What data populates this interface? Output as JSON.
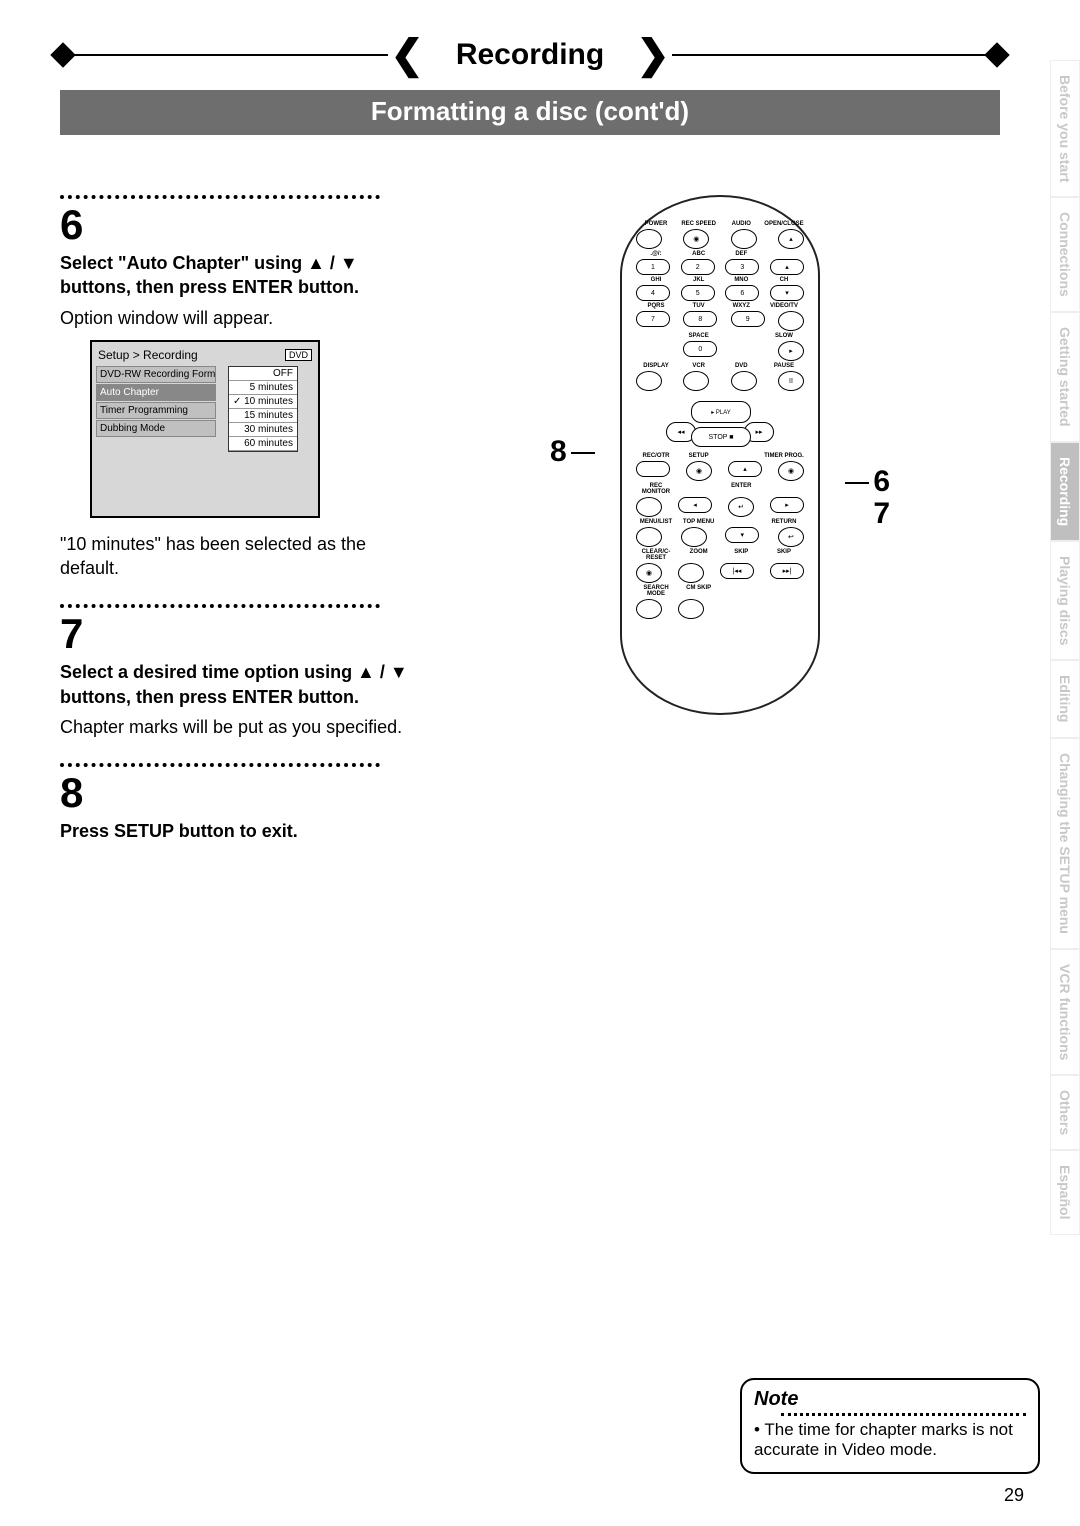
{
  "header": {
    "title": "Recording",
    "subtitle": "Formatting a disc (cont'd)"
  },
  "steps": {
    "s6": {
      "num": "6",
      "bold": "Select \"Auto Chapter\" using ▲ / ▼ buttons, then press ENTER button.",
      "body": "Option window will appear.",
      "after": "\"10 minutes\" has been selected as the default."
    },
    "s7": {
      "num": "7",
      "bold": "Select a desired time option using ▲ / ▼ buttons, then press ENTER button.",
      "body": "Chapter marks will be put as you specified."
    },
    "s8": {
      "num": "8",
      "bold": "Press SETUP button to exit."
    }
  },
  "setup_dialog": {
    "breadcrumb": "Setup > Recording",
    "tag": "DVD",
    "menu": [
      "DVD-RW Recording Forma",
      "Auto Chapter",
      "Timer Programming",
      "Dubbing Mode"
    ],
    "menu_active_index": 1,
    "options": [
      "OFF",
      "5 minutes",
      "10 minutes",
      "15 minutes",
      "30 minutes",
      "60 minutes"
    ],
    "option_selected_index": 2
  },
  "remote": {
    "labels_row1": [
      "POWER",
      "REC SPEED",
      "AUDIO",
      "OPEN/CLOSE"
    ],
    "labels_row2": [
      ".@/:",
      "ABC",
      "DEF",
      ""
    ],
    "nums_row2": [
      "1",
      "2",
      "3",
      "▴"
    ],
    "labels_row3": [
      "GHI",
      "JKL",
      "MNO",
      "CH"
    ],
    "nums_row3": [
      "4",
      "5",
      "6",
      "▾"
    ],
    "labels_row4": [
      "PQRS",
      "TUV",
      "WXYZ",
      "VIDEO/TV"
    ],
    "nums_row4": [
      "7",
      "8",
      "9",
      ""
    ],
    "labels_row5": [
      "",
      "SPACE",
      "",
      "SLOW"
    ],
    "nums_row5": [
      "",
      "0",
      "",
      "▸"
    ],
    "labels_row6": [
      "DISPLAY",
      "VCR",
      "DVD",
      "PAUSE"
    ],
    "nums_row6": [
      "",
      "",
      "",
      "II"
    ],
    "play": "▸ PLAY",
    "rew": "◂◂",
    "fwd": "▸▸",
    "stop": "STOP ■",
    "labels_row7": [
      "REC/OTR",
      "SETUP",
      "",
      "TIMER PROG."
    ],
    "labels_dpad_top": "▴",
    "labels_row8": [
      "REC MONITOR",
      "",
      "ENTER",
      ""
    ],
    "labels_row9": [
      "MENU/LIST",
      "TOP MENU",
      "",
      "RETURN"
    ],
    "labels_row10": [
      "CLEAR/C-RESET",
      "ZOOM",
      "SKIP",
      "SKIP"
    ],
    "labels_row11": [
      "SEARCH MODE",
      "CM SKIP",
      "",
      ""
    ]
  },
  "callouts": {
    "left": "8",
    "right1": "6",
    "right2": "7"
  },
  "note": {
    "title": "Note",
    "text": "• The time for chapter marks is not accurate in Video mode."
  },
  "sidetabs": [
    "Before you start",
    "Connections",
    "Getting started",
    "Recording",
    "Playing discs",
    "Editing",
    "Changing the SETUP menu",
    "VCR functions",
    "Others",
    "Español"
  ],
  "sidetab_active_index": 3,
  "page_number": "29"
}
